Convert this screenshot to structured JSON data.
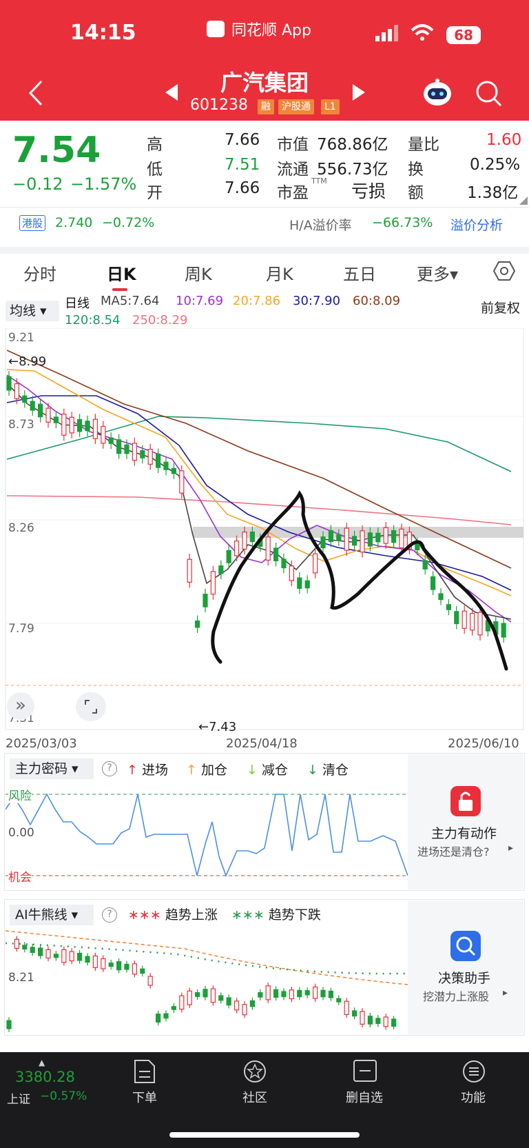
{
  "status": {
    "time": "14:15",
    "app": "同花顺 App",
    "battery": "68"
  },
  "header": {
    "title": "广汽集团",
    "code": "601238",
    "badges": [
      "融",
      "沪股通",
      "L1"
    ]
  },
  "quote": {
    "price": "7.54",
    "change": "−0.12",
    "pct": "−1.57%",
    "high_l": "高",
    "high": "7.66",
    "low_l": "低",
    "low": "7.51",
    "open_l": "开",
    "open": "7.66",
    "mcap_l": "市值",
    "mcap": "768.86亿",
    "float_l": "流通",
    "float": "556.73亿",
    "pe_l": "市盈",
    "pe_sup": "TTM",
    "pe": "亏损",
    "vr_l": "量比",
    "vr": "1.60",
    "turn_l": "换",
    "turn": "0.25%",
    "amt_l": "额",
    "amt": "1.38亿"
  },
  "hk": {
    "tag": "港股",
    "price": "2.740",
    "pct": "−0.72%",
    "prem_l": "H/A溢价率",
    "prem": "−66.73%",
    "analysis": "溢价分析"
  },
  "tabs": [
    "分时",
    "日K",
    "周K",
    "月K",
    "五日",
    "更多▾"
  ],
  "ma": {
    "selector": "均线",
    "line": "日线",
    "ma5": "MA5:7.64",
    "ma10": "10:7.69",
    "ma20": "20:7.86",
    "ma30": "30:7.90",
    "ma60": "60:8.09",
    "ma120": "120:8.54",
    "ma250": "250:8.29",
    "adj": "前复权"
  },
  "kline": {
    "y": [
      "9.21",
      "8.73",
      "8.26",
      "7.79",
      "7.31"
    ],
    "hi_mark": "←8.99",
    "lo_mark": "←7.43",
    "dates": [
      "2025/03/03",
      "2025/04/18",
      "2025/06/10"
    ]
  },
  "ind1": {
    "name": "主力密码",
    "legend": [
      "进场",
      "加仓",
      "减仓",
      "清仓"
    ],
    "risk": "风险",
    "zero": "0.00",
    "chance": "机会",
    "card_t": "主力有动作",
    "card_s": "进场还是清仓?"
  },
  "ind2": {
    "name": "AI牛熊线",
    "up": "趋势上涨",
    "down": "趋势下跌",
    "y": "8.21",
    "card_t": "决策助手",
    "card_s": "挖潜力上涨股"
  },
  "bottom": {
    "index": "3380.28",
    "index_name": "上证",
    "index_pct": "−0.57%",
    "nav": [
      "下单",
      "社区",
      "删自选",
      "功能"
    ]
  },
  "colors": {
    "red": "#e9303a",
    "green": "#1ba03a"
  }
}
